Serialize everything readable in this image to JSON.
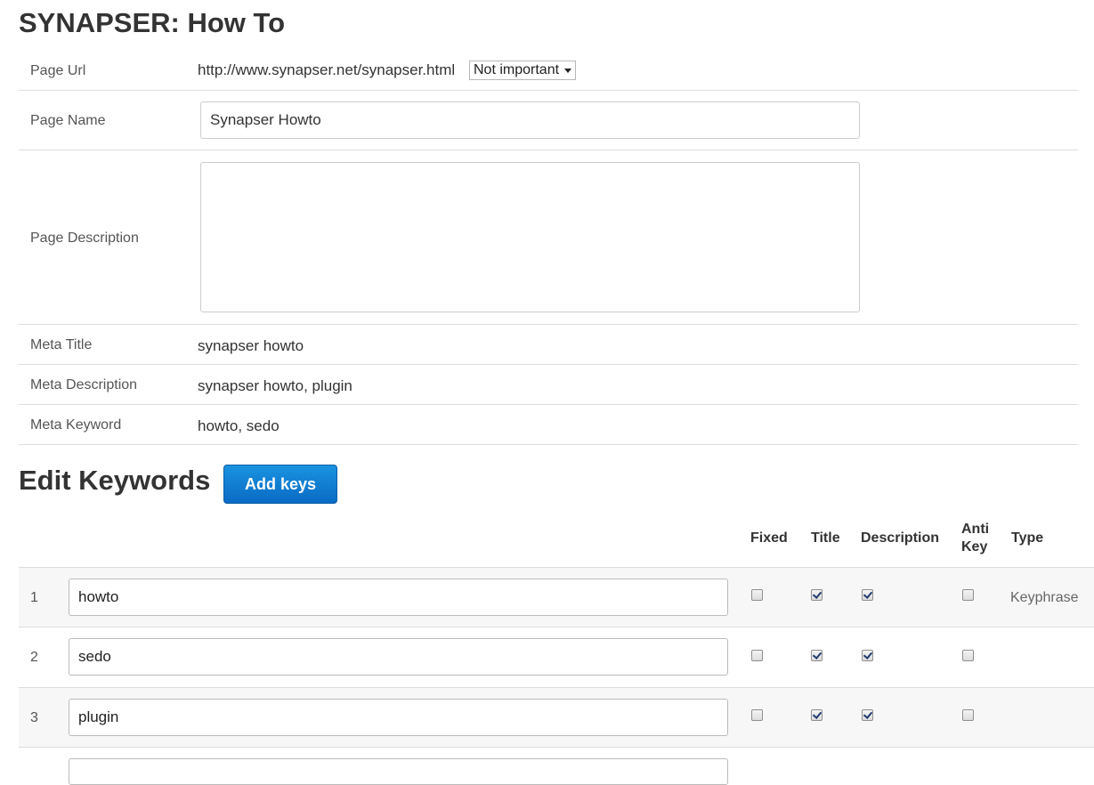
{
  "page_title": "SYNAPSER: How To",
  "info": {
    "url_label": "Page Url",
    "url_value": "http://www.synapser.net/synapser.html",
    "url_select_value": "Not important",
    "name_label": "Page Name",
    "name_value": "Synapser Howto",
    "description_label": "Page Description",
    "description_value": "",
    "meta_title_label": "Meta Title",
    "meta_title_value": "synapser howto",
    "meta_description_label": "Meta Description",
    "meta_description_value": "synapser howto, plugin",
    "meta_keyword_label": "Meta Keyword",
    "meta_keyword_value": "howto, sedo"
  },
  "keywords_section": {
    "heading": "Edit Keywords",
    "add_button": "Add keys",
    "columns": {
      "fixed": "Fixed",
      "title": "Title",
      "description": "Description",
      "anti_key_line1": "Anti",
      "anti_key_line2": "Key",
      "type": "Type"
    },
    "rows": [
      {
        "num": "1",
        "keyword": "howto",
        "fixed": false,
        "title": true,
        "description": true,
        "anti_key": false,
        "type": "Keyphrase"
      },
      {
        "num": "2",
        "keyword": "sedo",
        "fixed": false,
        "title": true,
        "description": true,
        "anti_key": false,
        "type": ""
      },
      {
        "num": "3",
        "keyword": "plugin",
        "fixed": false,
        "title": true,
        "description": true,
        "anti_key": false,
        "type": ""
      }
    ]
  }
}
